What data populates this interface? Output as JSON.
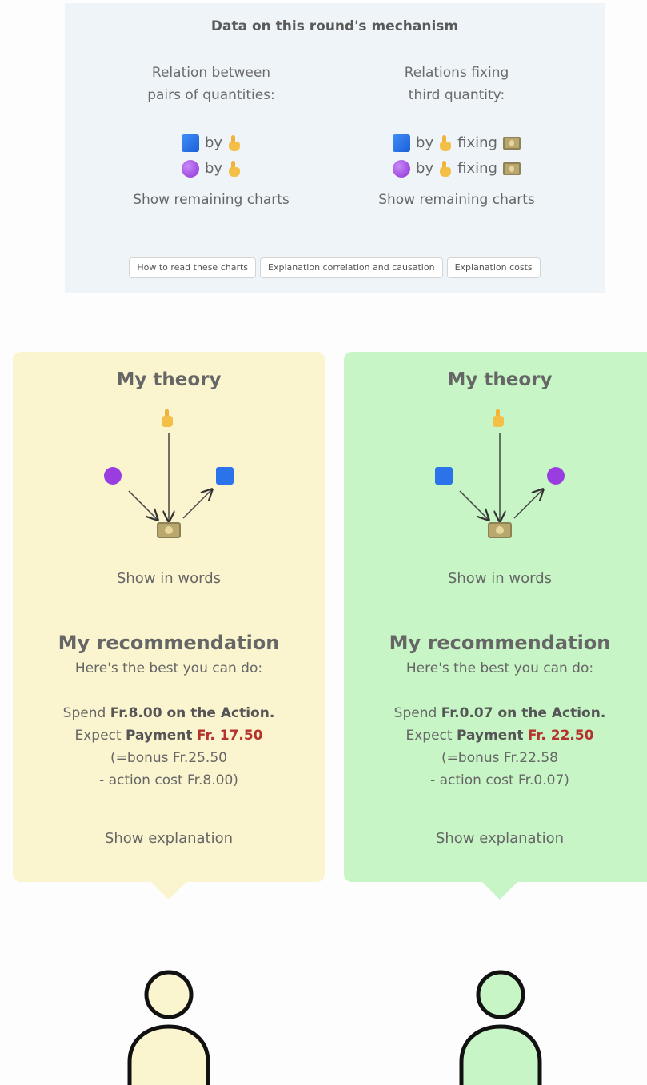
{
  "data_panel": {
    "title": "Data on this round's mechanism",
    "left_col": {
      "heading_line1": "Relation between",
      "heading_line2": "pairs of quantities:",
      "rows": [
        {
          "icon_a": "blue-square-icon",
          "connector": "by",
          "icon_b": "pointing-hand-icon"
        },
        {
          "icon_a": "purple-circle-icon",
          "connector": "by",
          "icon_b": "pointing-hand-icon"
        }
      ],
      "link": "Show remaining charts"
    },
    "right_col": {
      "heading_line1": "Relations fixing",
      "heading_line2": "third quantity:",
      "rows": [
        {
          "icon_a": "blue-square-icon",
          "connector": "by",
          "icon_b": "pointing-hand-icon",
          "fixing": "fixing",
          "icon_c": "money-icon"
        },
        {
          "icon_a": "purple-circle-icon",
          "connector": "by",
          "icon_b": "pointing-hand-icon",
          "fixing": "fixing",
          "icon_c": "money-icon"
        }
      ],
      "link": "Show remaining charts"
    },
    "buttons": [
      "How to read these charts",
      "Explanation correlation and causation",
      "Explanation costs"
    ]
  },
  "cards": [
    {
      "color": "#faf5cf",
      "title": "My theory",
      "show_words": "Show in words",
      "rec_title": "My recommendation",
      "rec_sub": "Here's the best you can do:",
      "spend_prefix": "Spend ",
      "spend_value": "Fr.8.00 on the Action.",
      "expect_prefix": "Expect ",
      "payment_label": "Payment",
      "payment_value": "Fr. 17.50",
      "bonus_line": "(=bonus Fr.25.50",
      "cost_line": "- action cost Fr.8.00)",
      "show_explanation": "Show explanation"
    },
    {
      "color": "#c7f5c6",
      "title": "My theory",
      "show_words": "Show in words",
      "rec_title": "My recommendation",
      "rec_sub": "Here's the best you can do:",
      "spend_prefix": "Spend ",
      "spend_value": "Fr.0.07 on the Action.",
      "expect_prefix": "Expect ",
      "payment_label": "Payment",
      "payment_value": "Fr. 22.50",
      "bonus_line": "(=bonus Fr.22.58",
      "cost_line": "- action cost Fr.0.07)",
      "show_explanation": "Show explanation"
    }
  ],
  "colors": {
    "accent_payment": "#b5322d",
    "avatar_yellow": "#faf5cf",
    "avatar_green": "#c7f5c6"
  }
}
